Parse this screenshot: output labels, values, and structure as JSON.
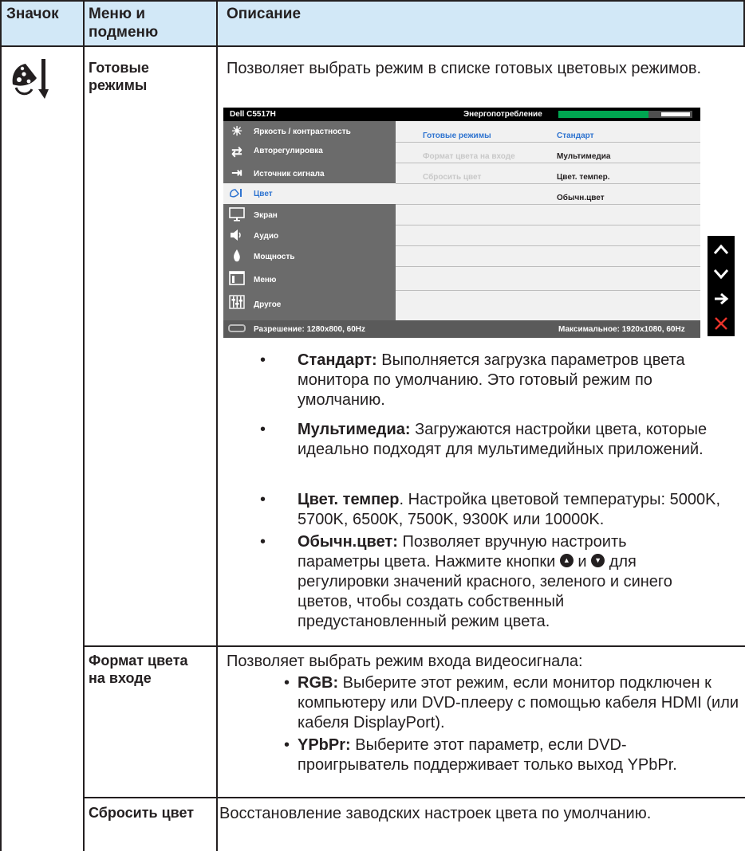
{
  "header": {
    "col_icon": "Значок",
    "col_menu": "Меню и подменю",
    "col_desc": "Описание"
  },
  "rows": {
    "preset": {
      "label": "Готовые режимы",
      "desc": "Позволяет выбрать режим в списке готовых цветовых режимов.",
      "bullets": [
        {
          "term": "Стандарт:",
          "text": "Выполняется загрузка параметров цвета монитора по умолчанию. Это готовый режим по умолчанию."
        },
        {
          "term": "Мультимедиа:",
          "text": "Загружаются настройки цвета, которые идеально подходят для мультимедийных приложений."
        },
        {
          "term": "Цвет. темпер",
          "text": ". Настройка цветовой температуры: 5000K, 5700K, 6500K, 7500K, 9300K или 10000K."
        },
        {
          "term": "Обычн.цвет:",
          "text_a": "Позволяет вручную настроить параметры цвета. Нажмите кнопки",
          "and": "и",
          "text_b": "для регулировки значений красного, зеленого и синего цветов, чтобы создать собственный предустановленный режим цвета."
        }
      ]
    },
    "input_format": {
      "label": "Формат цвета на входе",
      "desc": "Позволяет выбрать режим входа видеосигнала:",
      "bullets": [
        {
          "term": "RGB:",
          "text": "Выберите этот режим, если монитор подключен к компьютеру или DVD-плееру с помощью кабеля HDMI (или кабеля DisplayPort)."
        },
        {
          "term": "YPbPr:",
          "text": "Выберите этот параметр, если DVD-проигрыватель поддерживает только выход YPbPr."
        }
      ]
    },
    "reset": {
      "label": "Сбросить цвет",
      "desc": "Восстановление заводских настроек цвета по умолчанию."
    }
  },
  "osd": {
    "model": "Dell C5517H",
    "energy_label": "Энергопотребление",
    "energy_level": 0.67,
    "menu": [
      {
        "icon": "brightness-icon",
        "label": "Яркость / контрастность"
      },
      {
        "icon": "auto-adjust-icon",
        "label": "Авторегулировка"
      },
      {
        "icon": "input-source-icon",
        "label": "Источник сигнала"
      },
      {
        "icon": "color-icon",
        "label": "Цвет",
        "selected": true
      },
      {
        "icon": "display-icon",
        "label": "Экран"
      },
      {
        "icon": "audio-icon",
        "label": "Аудио"
      },
      {
        "icon": "power-icon",
        "label": "Мощность"
      },
      {
        "icon": "menu-icon",
        "label": "Меню"
      },
      {
        "icon": "other-icon",
        "label": "Другое"
      }
    ],
    "submenu": [
      "Готовые режимы",
      "Формат цвета на входе",
      "Сбросить цвет"
    ],
    "options": [
      "Стандарт",
      "Мультимедиа",
      "Цвет. темпер.",
      "Обычн.цвет"
    ],
    "resolution": "Разрешение: 1280x800, 60Hz",
    "max_resolution": "Максимальное: 1920x1080, 60Hz",
    "keys": [
      "up",
      "down",
      "right",
      "close"
    ],
    "colors": {
      "accent": "#2f74d0",
      "energy": "#00a651",
      "close": "#e8332a",
      "header": "#d2e8f7"
    }
  }
}
